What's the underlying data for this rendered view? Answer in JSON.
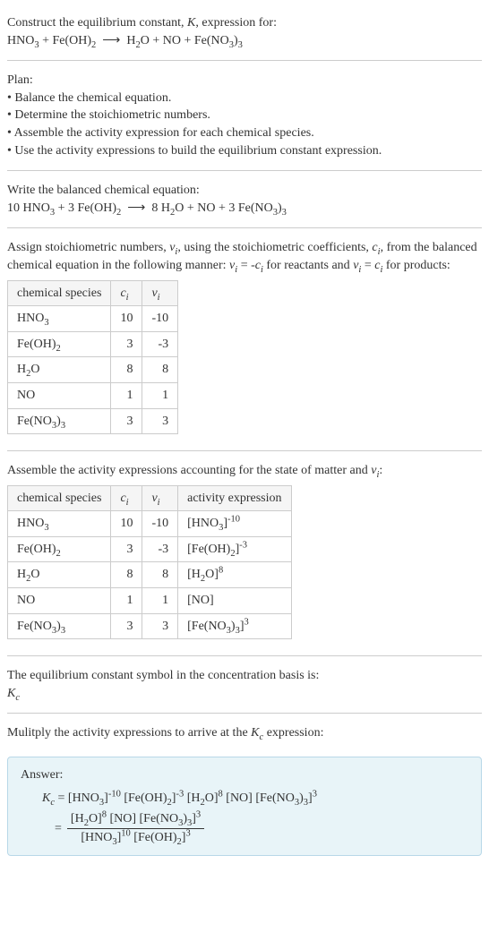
{
  "header": {
    "line1": "Construct the equilibrium constant, K, expression for:",
    "equation": "HNO₃ + Fe(OH)₂ ⟶ H₂O + NO + Fe(NO₃)₃"
  },
  "plan": {
    "title": "Plan:",
    "items": [
      "• Balance the chemical equation.",
      "• Determine the stoichiometric numbers.",
      "• Assemble the activity expression for each chemical species.",
      "• Use the activity expressions to build the equilibrium constant expression."
    ]
  },
  "balanced": {
    "title": "Write the balanced chemical equation:",
    "equation": "10 HNO₃ + 3 Fe(OH)₂ ⟶ 8 H₂O + NO + 3 Fe(NO₃)₃"
  },
  "stoich": {
    "intro": "Assign stoichiometric numbers, νᵢ, using the stoichiometric coefficients, cᵢ, from the balanced chemical equation in the following manner: νᵢ = -cᵢ for reactants and νᵢ = cᵢ for products:",
    "headers": [
      "chemical species",
      "cᵢ",
      "νᵢ"
    ],
    "rows": [
      [
        "HNO₃",
        "10",
        "-10"
      ],
      [
        "Fe(OH)₂",
        "3",
        "-3"
      ],
      [
        "H₂O",
        "8",
        "8"
      ],
      [
        "NO",
        "1",
        "1"
      ],
      [
        "Fe(NO₃)₃",
        "3",
        "3"
      ]
    ]
  },
  "activity": {
    "intro": "Assemble the activity expressions accounting for the state of matter and νᵢ:",
    "headers": [
      "chemical species",
      "cᵢ",
      "νᵢ",
      "activity expression"
    ],
    "rows": [
      [
        "HNO₃",
        "10",
        "-10",
        "[HNO₃]⁻¹⁰"
      ],
      [
        "Fe(OH)₂",
        "3",
        "-3",
        "[Fe(OH)₂]⁻³"
      ],
      [
        "H₂O",
        "8",
        "8",
        "[H₂O]⁸"
      ],
      [
        "NO",
        "1",
        "1",
        "[NO]"
      ],
      [
        "Fe(NO₃)₃",
        "3",
        "3",
        "[Fe(NO₃)₃]³"
      ]
    ]
  },
  "symbol": {
    "line1": "The equilibrium constant symbol in the concentration basis is:",
    "line2": "K_c"
  },
  "multiply": {
    "text": "Mulitply the activity expressions to arrive at the K_c expression:"
  },
  "answer": {
    "title": "Answer:",
    "eq_lhs": "K_c = ",
    "eq_rhs1": "[HNO₃]⁻¹⁰ [Fe(OH)₂]⁻³ [H₂O]⁸ [NO] [Fe(NO₃)₃]³",
    "frac_top": "[H₂O]⁸ [NO] [Fe(NO₃)₃]³",
    "frac_bot": "[HNO₃]¹⁰ [Fe(OH)₂]³"
  }
}
